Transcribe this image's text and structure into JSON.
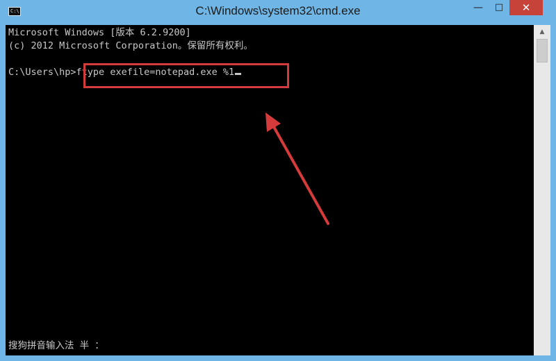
{
  "window": {
    "title": "C:\\Windows\\system32\\cmd.exe",
    "icon": "cmd-icon",
    "icon_glyph": "C:\\",
    "controls": {
      "minimize": "—",
      "maximize": "□",
      "close": "✕"
    }
  },
  "console": {
    "lines": [
      "Microsoft Windows [版本 6.2.9200]",
      "(c) 2012 Microsoft Corporation。保留所有权利。"
    ],
    "prompt": "C:\\Users\\hp>",
    "command": "ftype exefile=notepad.exe %1",
    "ime_status": "搜狗拼音输入法 半 ："
  },
  "annotation": {
    "box_color": "#d63b3b",
    "arrow_color": "#d63b3b"
  },
  "scrollbar": {
    "up_arrow": "▲"
  },
  "colors": {
    "frame": "#6fb6e6",
    "console_bg": "#000000",
    "console_text": "#c8c8c8",
    "close_button": "#c7433a"
  }
}
